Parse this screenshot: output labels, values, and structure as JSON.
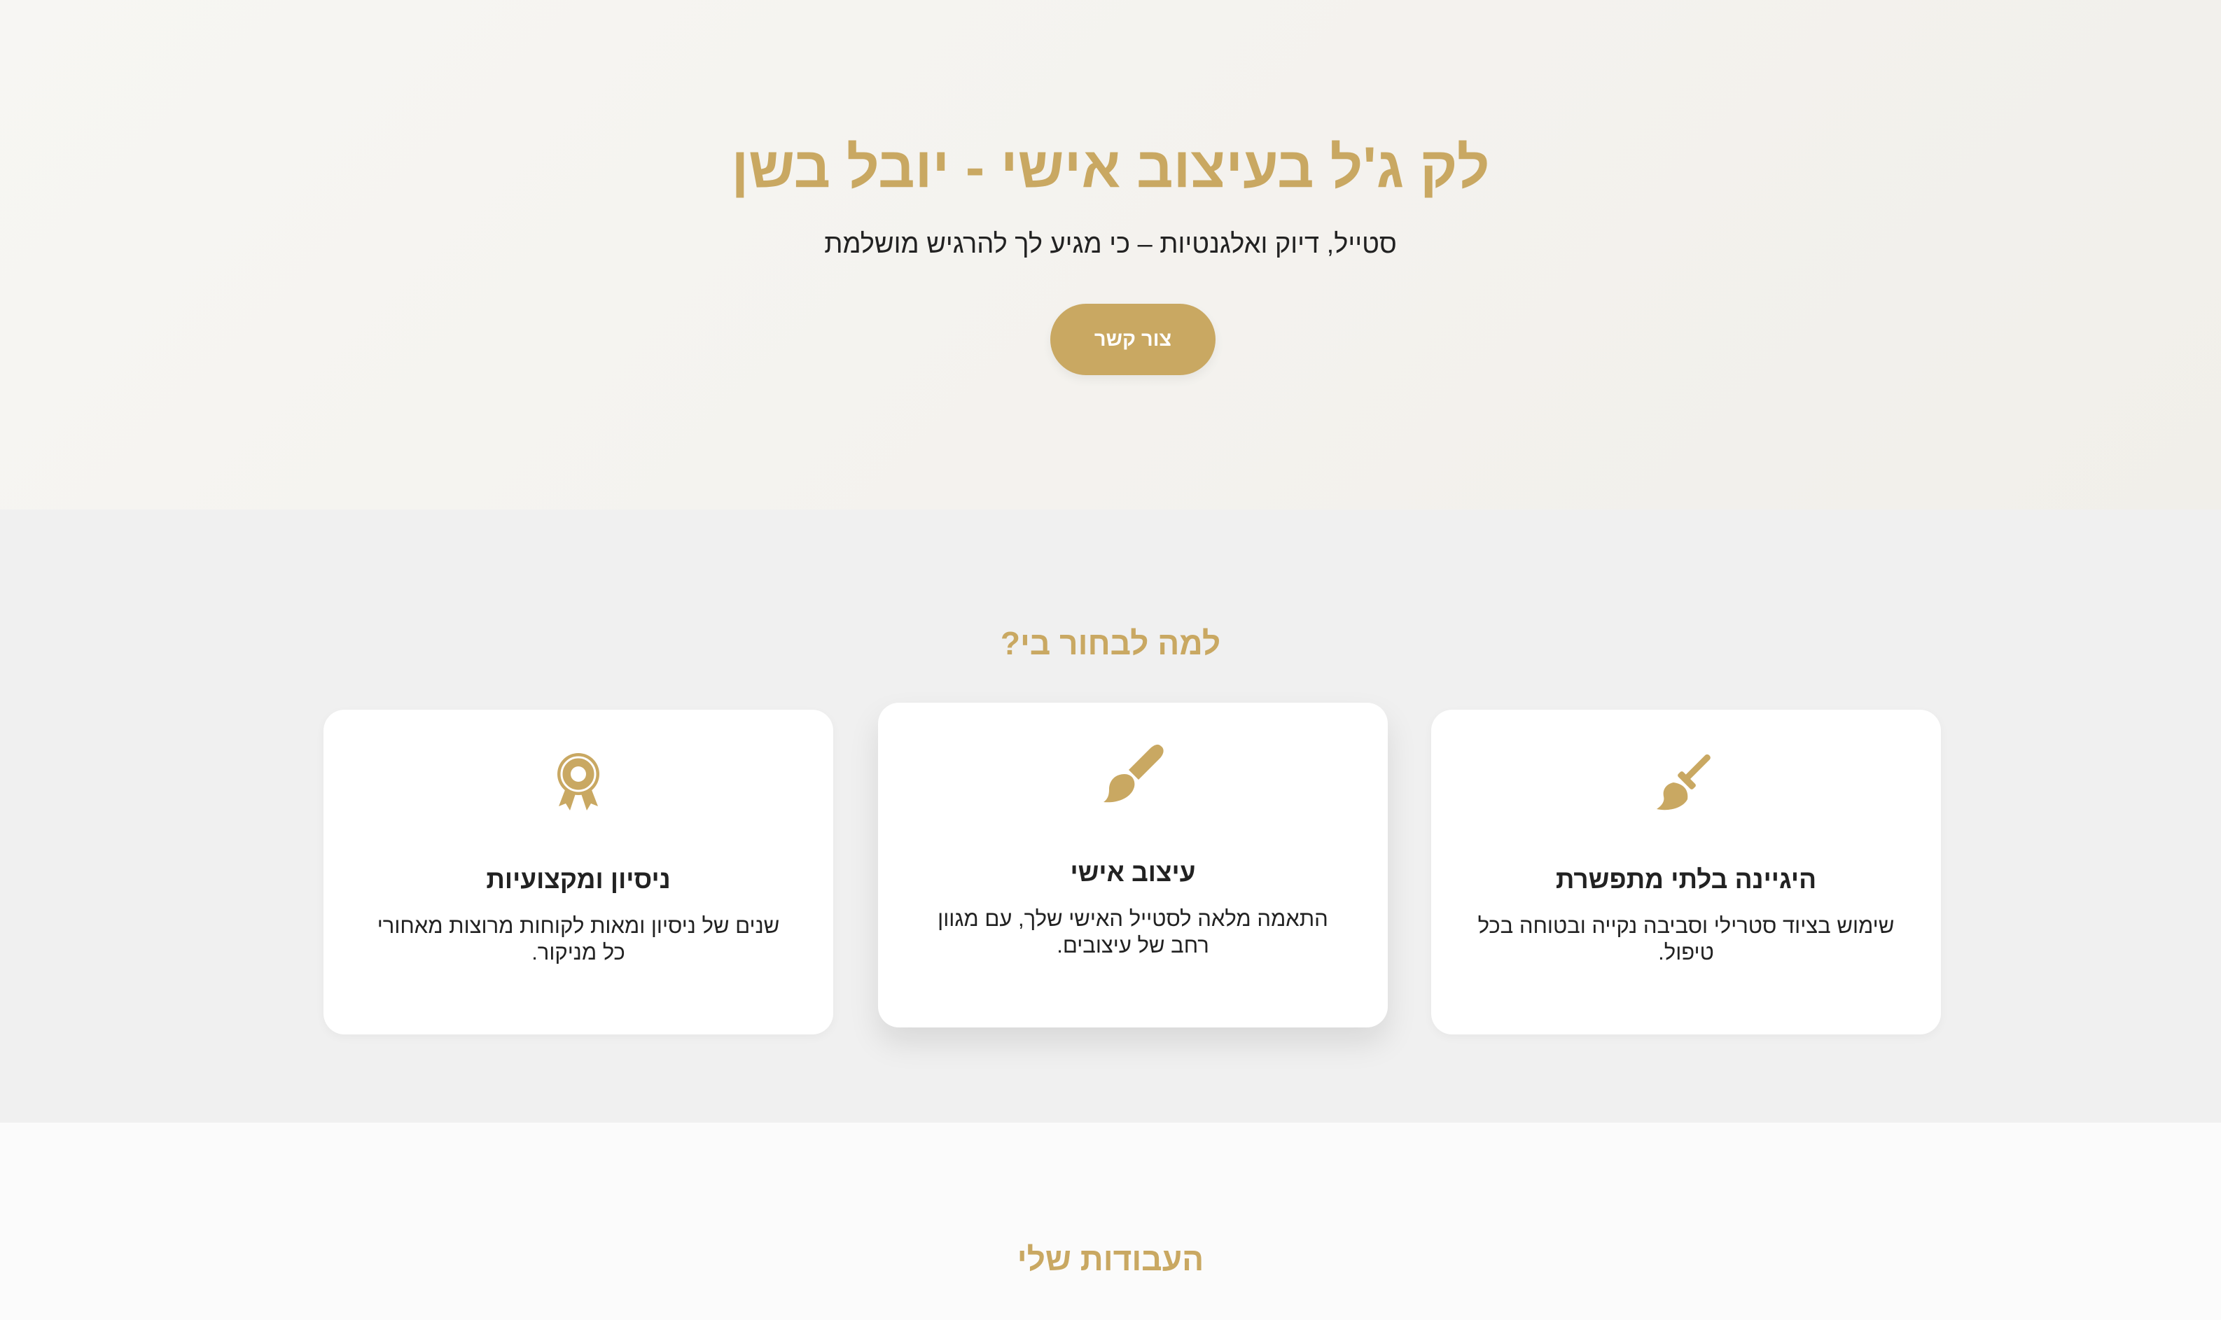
{
  "hero": {
    "title": "לק ג'ל בעיצוב אישי - יובל בשן",
    "subtitle": "סטייל, דיוק ואלגנטיות – כי מגיע לך להרגיש מושלמת",
    "cta_label": "צור קשר"
  },
  "features": {
    "title": "למה לבחור בי?",
    "cards": [
      {
        "icon": "broom-icon",
        "title": "היגיינה בלתי מתפשרת",
        "text": "שימוש בציוד סטרילי וסביבה נקייה ובטוחה בכל טיפול."
      },
      {
        "icon": "paintbrush-icon",
        "title": "עיצוב אישי",
        "text": "התאמה מלאה לסטייל האישי שלך, עם מגוון רחב של עיצובים."
      },
      {
        "icon": "award-icon",
        "title": "ניסיון ומקצועיות",
        "text": "שנים של ניסיון ומאות לקוחות מרוצות מאחורי כל מניקור."
      }
    ]
  },
  "works": {
    "title": "העבודות שלי"
  },
  "colors": {
    "accent": "#c9a862",
    "text": "#222222",
    "section_bg": "#f0f0f0",
    "card_bg": "#ffffff"
  }
}
